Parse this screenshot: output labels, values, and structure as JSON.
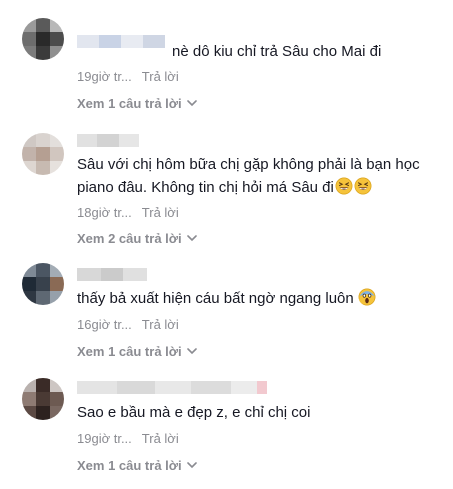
{
  "comments": [
    {
      "text": "nè dô kiu chỉ trả Sâu cho Mai đi",
      "time": "19giờ tr...",
      "reply_label": "Trả lời",
      "view_replies_label": "Xem 1 câu trả lời"
    },
    {
      "text_line1": "Sâu với chị hôm bữa chị gặp không phải là bạn học",
      "text_line2": "piano đâu. Không tin chị hỏi má Sâu đi",
      "emoji": "grinning-squinting-face",
      "time": "18giờ tr...",
      "reply_label": "Trả lời",
      "view_replies_label": "Xem 2 câu trả lời"
    },
    {
      "text": "thấy bả xuất hiện cáu bất ngờ ngang luôn",
      "emoji": "face-screaming-in-fear",
      "time": "16giờ tr...",
      "reply_label": "Trả lời",
      "view_replies_label": "Xem 1 câu trả lời"
    },
    {
      "text": "Sao e bầu mà e đẹp z, e chỉ chị coi",
      "time": "19giờ tr...",
      "reply_label": "Trả lời",
      "view_replies_label": "Xem 1 câu trả lời"
    }
  ],
  "colors": {
    "text": "#161823",
    "secondary": "#8a8b91"
  },
  "icons": {
    "expand": "chevron-down-icon"
  }
}
